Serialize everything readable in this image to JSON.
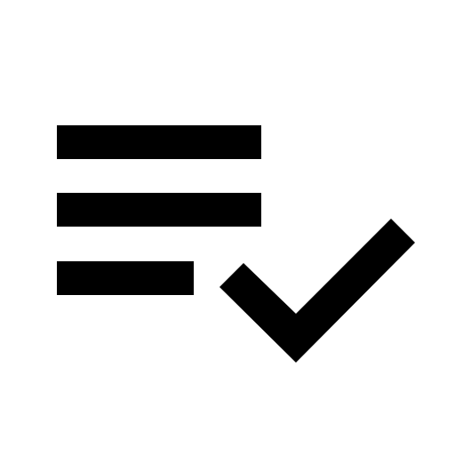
{
  "icon": {
    "name": "playlist-add-check-icon",
    "color": "#000000",
    "background": "#ffffff"
  }
}
